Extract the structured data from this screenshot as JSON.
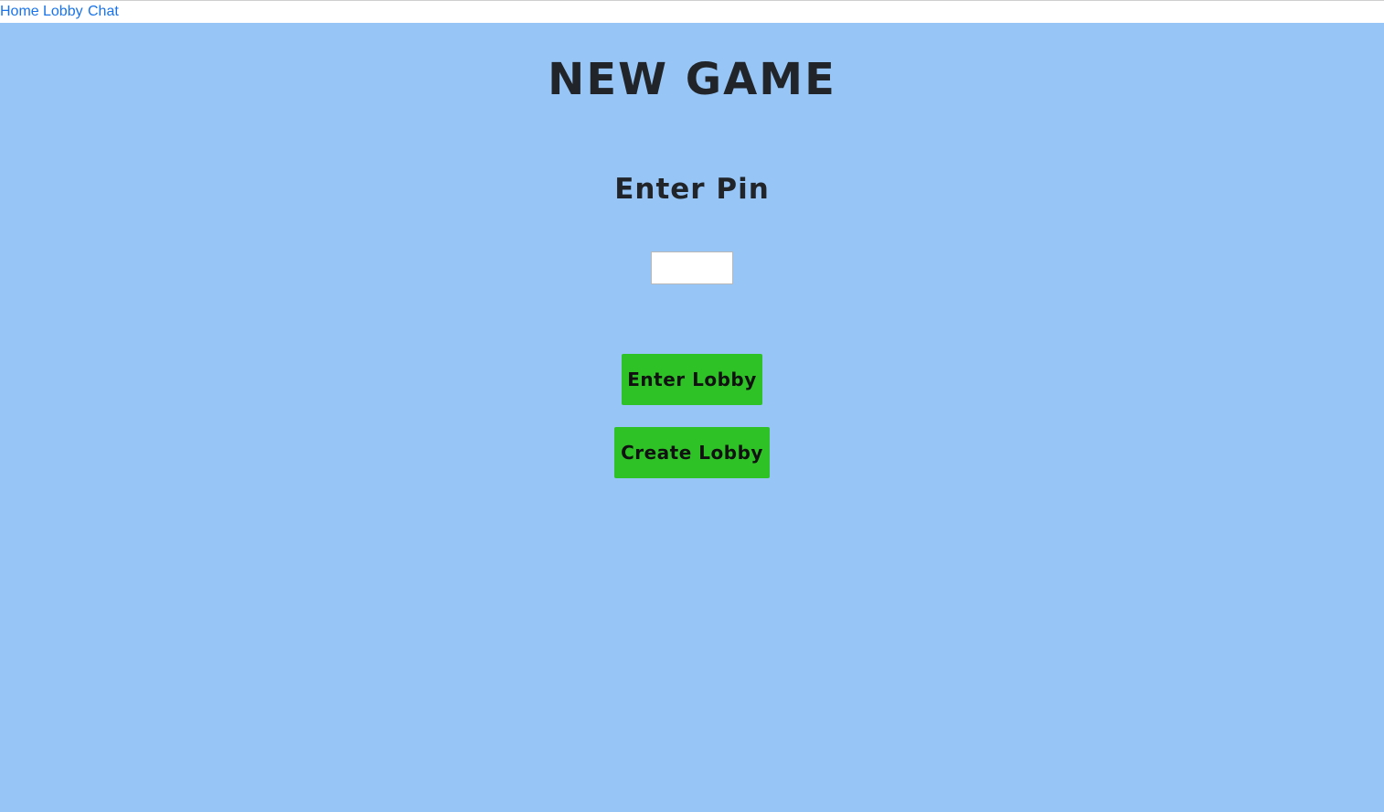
{
  "nav": {
    "items": [
      {
        "label": "Home"
      },
      {
        "label": "Lobby"
      },
      {
        "label": "Chat"
      }
    ]
  },
  "page": {
    "title": "NEW GAME",
    "pin_label": "Enter Pin",
    "pin_input": {
      "value": "",
      "placeholder": ""
    },
    "buttons": {
      "enter_lobby": "Enter Lobby",
      "create_lobby": "Create Lobby"
    }
  },
  "colors": {
    "background": "#97c5f6",
    "button": "#2ec227",
    "link": "#1a73e8",
    "heading": "#212529"
  }
}
